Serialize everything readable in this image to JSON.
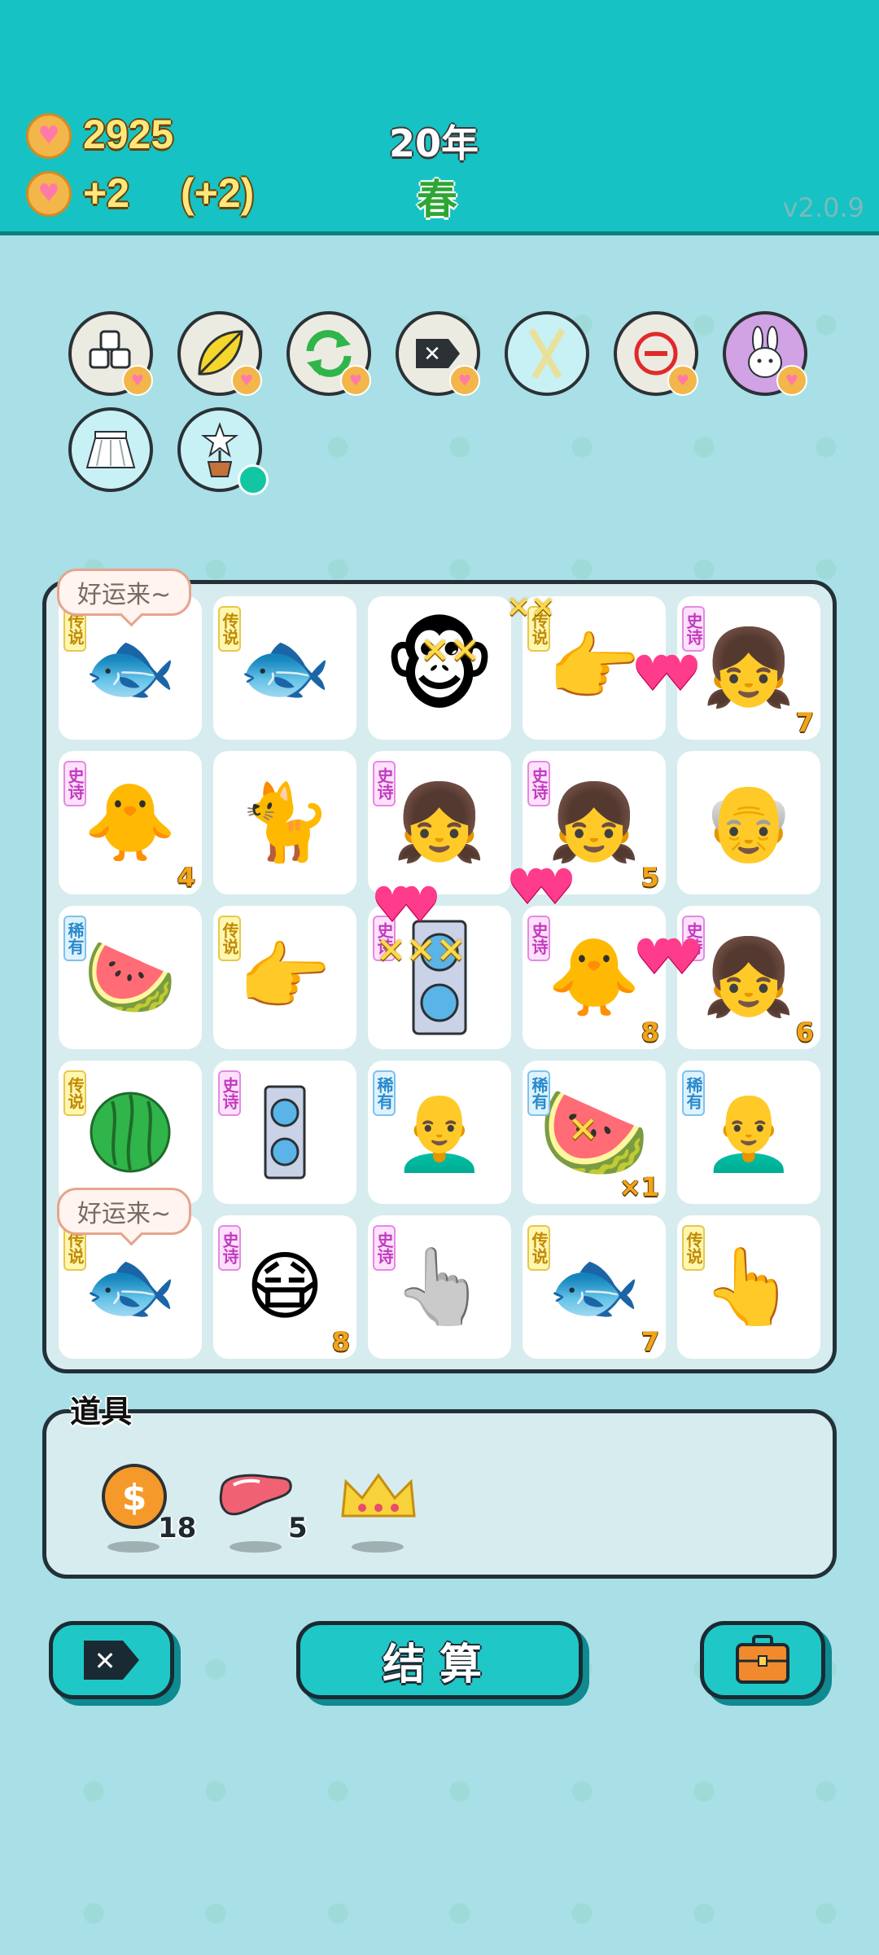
{
  "header": {
    "coins": "2925",
    "income": "+2",
    "income_bonus": "(+2)",
    "year": "20年",
    "season": "春",
    "version": "v2.0.9"
  },
  "relics": [
    {
      "icon": "dice-pile-icon"
    },
    {
      "icon": "leaf-icon"
    },
    {
      "icon": "recycle-icon"
    },
    {
      "icon": "delete-tag-icon"
    },
    {
      "icon": "chopsticks-icon"
    },
    {
      "icon": "minus-circle-icon"
    },
    {
      "icon": "bunny-icon"
    },
    {
      "icon": "skirt-icon"
    },
    {
      "icon": "potted-flower-icon"
    }
  ],
  "rarity": {
    "legend": "传说",
    "epic": "史诗",
    "rare": "稀有"
  },
  "bubble_text": "好运来~",
  "board": {
    "counts": {
      "r1c5": "7",
      "r2c1": "4",
      "r2c4": "5",
      "r3c4": "8",
      "r3c5": "6",
      "r4c4": "×1",
      "r5c2": "8",
      "r5c4": "7"
    }
  },
  "items_title": "道具",
  "items": [
    {
      "icon": "dollar-coin-icon",
      "count": "18"
    },
    {
      "icon": "liver-icon",
      "count": "5"
    },
    {
      "icon": "crown-icon",
      "count": ""
    }
  ],
  "buttons": {
    "settle": "结算"
  },
  "colors": {
    "topbar": "#16c2c3",
    "background": "#a9dfe6",
    "coin_text": "#ffe77e",
    "season": "#2da633",
    "button": "#1fc8c6"
  }
}
